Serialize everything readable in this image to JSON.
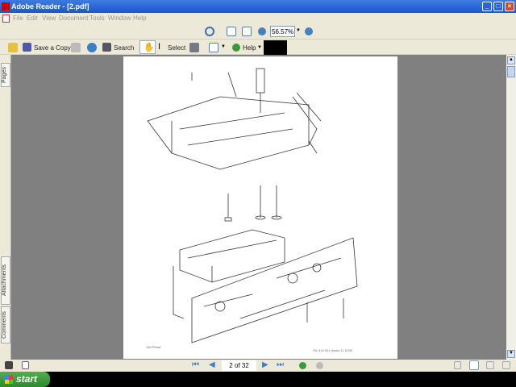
{
  "window": {
    "title": "Adobe Reader - [2.pdf]",
    "controls": [
      "minimize",
      "maximize",
      "close"
    ]
  },
  "menu": [
    "File",
    "Edit",
    "View",
    "Document",
    "Tools",
    "Window",
    "Help"
  ],
  "toolbar": {
    "zoom_value": "56.57%",
    "save_copy": "Save a Copy",
    "search": "Search",
    "select": "Select",
    "help": "Help"
  },
  "side_tabs": [
    "Pages",
    "Attachments",
    "Comments"
  ],
  "document": {
    "footer_left": "145 Prima",
    "footer_right": "SIL 413 001 (Issue 1) 10/92"
  },
  "navigation": {
    "page_indicator": "2 of 32"
  },
  "taskbar": {
    "start": "start"
  }
}
